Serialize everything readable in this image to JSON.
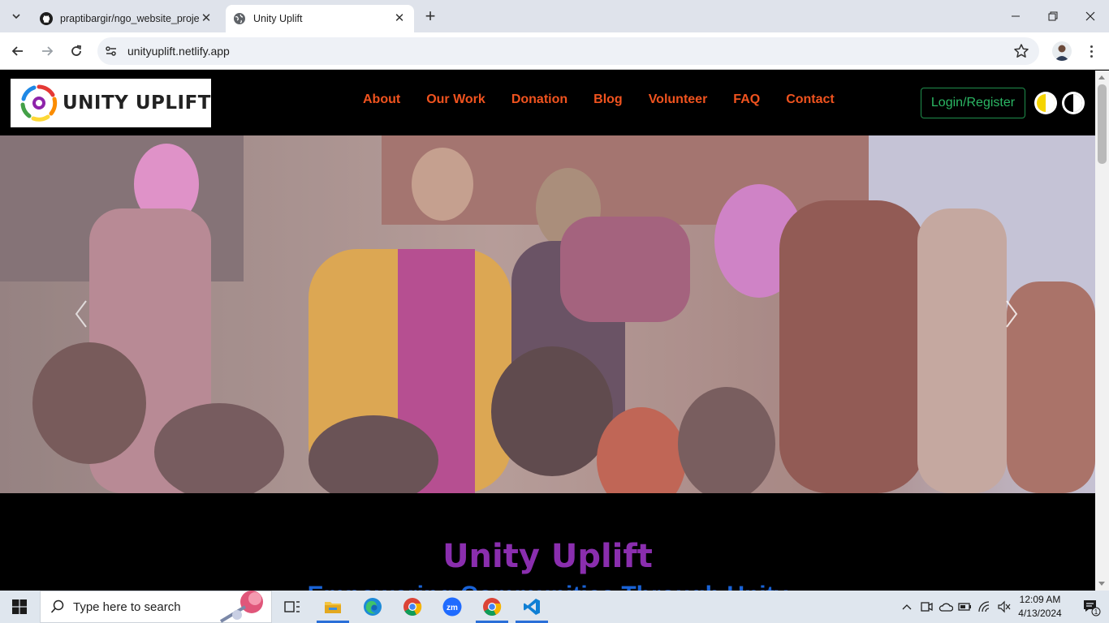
{
  "browser": {
    "tabs": [
      {
        "title": "praptibargir/ngo_website_proje",
        "icon": "github-icon",
        "active": false
      },
      {
        "title": "Unity Uplift",
        "icon": "globe-icon",
        "active": true
      }
    ],
    "url": "unityuplift.netlify.app"
  },
  "site": {
    "logo_text": "UNITY UPLIFT",
    "nav": [
      "About",
      "Our Work",
      "Donation",
      "Blog",
      "Volunteer",
      "FAQ",
      "Contact"
    ],
    "login_label": "Login/Register",
    "hero_title": "Unity Uplift",
    "hero_subtitle": "Empowering Communities Through Unity",
    "colors": {
      "nav": "#f0531f",
      "login": "#2bb764",
      "title": "#8a2eae",
      "subtitle": "#1a63d6"
    }
  },
  "taskbar": {
    "search_placeholder": "Type here to search",
    "time": "12:09 AM",
    "date": "4/13/2024",
    "notification_count": "1",
    "apps": [
      "task-view-icon",
      "file-explorer-icon",
      "edge-icon",
      "chrome-icon",
      "zoom-icon",
      "chrome-icon",
      "vscode-icon"
    ]
  }
}
